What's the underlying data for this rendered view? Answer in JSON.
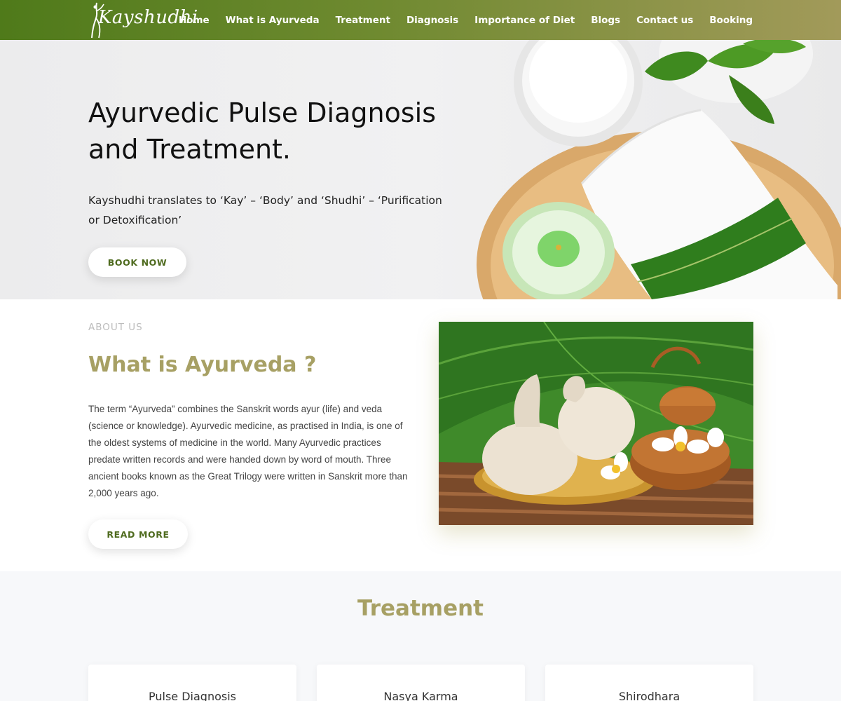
{
  "brand": {
    "logo_text": "Kayshudhi",
    "accent": "#a7a064",
    "nav_green": "#4f7a1a"
  },
  "nav": {
    "items": [
      {
        "label": "Home"
      },
      {
        "label": "What is Ayurveda"
      },
      {
        "label": "Treatment"
      },
      {
        "label": "Diagnosis"
      },
      {
        "label": "Importance of Diet"
      },
      {
        "label": "Blogs"
      },
      {
        "label": "Contact us"
      },
      {
        "label": "Booking"
      }
    ]
  },
  "hero": {
    "title_line1": "Ayurvedic Pulse Diagnosis",
    "title_line2": "and Treatment.",
    "subtitle": "Kayshudhi translates to ‘Kay’ – ‘Body’ and ‘Shudhi’ – ‘Purification or Detoxification’",
    "button": "BOOK NOW"
  },
  "about": {
    "kicker": "ABOUT US",
    "title": "What is Ayurveda ?",
    "body": "The term “Ayurveda” combines the Sanskrit words ayur (life) and veda (science or knowledge). Ayurvedic medicine, as practised in India, is one of the oldest systems of medicine in the world. Many Ayurvedic practices predate written records and were handed down by word of mouth. Three ancient books known as the Great Trilogy were written in Sanskrit more than 2,000 years ago.",
    "button": "READ MORE"
  },
  "treatment": {
    "title": "Treatment",
    "cards": [
      {
        "label": "Pulse Diagnosis"
      },
      {
        "label": "Nasya Karma"
      },
      {
        "label": "Shirodhara"
      }
    ]
  }
}
